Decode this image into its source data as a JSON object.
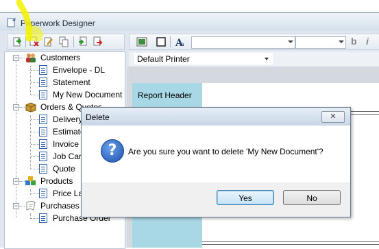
{
  "window": {
    "title": "Paperwork Designer"
  },
  "toolbar": {
    "buttons": [
      "add-icon",
      "delete-icon",
      "edit-icon",
      "copy-icon",
      "import-icon",
      "export-icon"
    ],
    "format_buttons": [
      "image-icon",
      "rectangle-icon",
      "text-format-icon"
    ],
    "bold": "b",
    "italic": "i"
  },
  "printer": {
    "selected": "Default Printer"
  },
  "tree": {
    "groups": [
      {
        "label": "Customers",
        "icon": "customers-icon",
        "items": [
          "Envelope - DL",
          "Statement",
          "My New Document"
        ]
      },
      {
        "label": "Orders & Quotes",
        "icon": "orders-icon",
        "items": [
          "Delivery",
          "Estimate",
          "Invoice",
          "Job Card",
          "Quote"
        ]
      },
      {
        "label": "Products",
        "icon": "products-icon",
        "items": [
          "Price La"
        ]
      },
      {
        "label": "Purchases",
        "icon": "purchases-icon",
        "items": [
          "Purchase Order"
        ]
      }
    ]
  },
  "designer": {
    "band_label": "Report Header"
  },
  "dialog": {
    "title": "Delete",
    "close_glyph": "✕",
    "icon": "question-icon",
    "icon_glyph": "?",
    "message": "Are you sure you want to delete 'My New Document'?",
    "yes_label": "Yes",
    "no_label": "No"
  },
  "colors": {
    "highlight": "#f2f200",
    "band": "#a8d8e6",
    "accent": "#1c4fb0"
  }
}
